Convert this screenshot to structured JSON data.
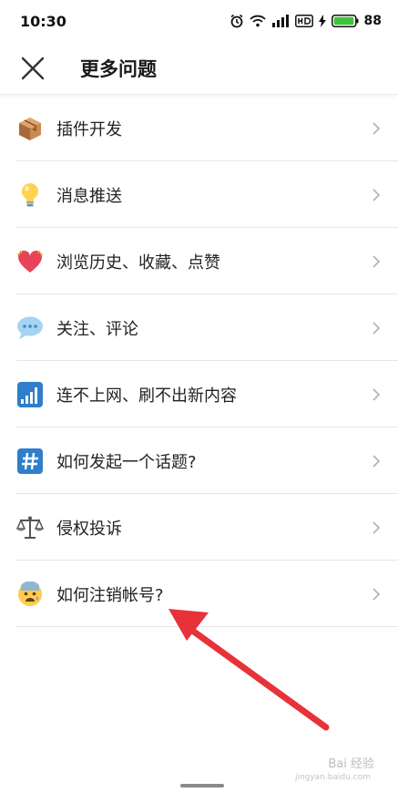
{
  "status_bar": {
    "time": "10:30",
    "battery": "88",
    "icons": [
      "alarm-icon",
      "wifi-icon",
      "signal-icon",
      "hd-icon",
      "charging-icon",
      "battery-icon"
    ]
  },
  "header": {
    "title": "更多问题",
    "close_icon": "close-icon"
  },
  "items": [
    {
      "label": "插件开发",
      "icon": "package-icon"
    },
    {
      "label": "消息推送",
      "icon": "lightbulb-icon"
    },
    {
      "label": "浏览历史、收藏、点赞",
      "icon": "heart-icon"
    },
    {
      "label": "关注、评论",
      "icon": "speech-bubble-icon"
    },
    {
      "label": "连不上网、刷不出新内容",
      "icon": "signal-bars-icon"
    },
    {
      "label": "如何发起一个话题?",
      "icon": "hashtag-icon"
    },
    {
      "label": "侵权投诉",
      "icon": "scales-icon"
    },
    {
      "label": "如何注销帐号?",
      "icon": "worried-face-icon"
    }
  ],
  "watermark": {
    "text": "Bai 经验",
    "sub": "jingyan.baidu.com"
  },
  "colors": {
    "accent_arrow": "#e8323a",
    "battery_green": "#3fc23b",
    "divider": "#e6e6e6"
  }
}
